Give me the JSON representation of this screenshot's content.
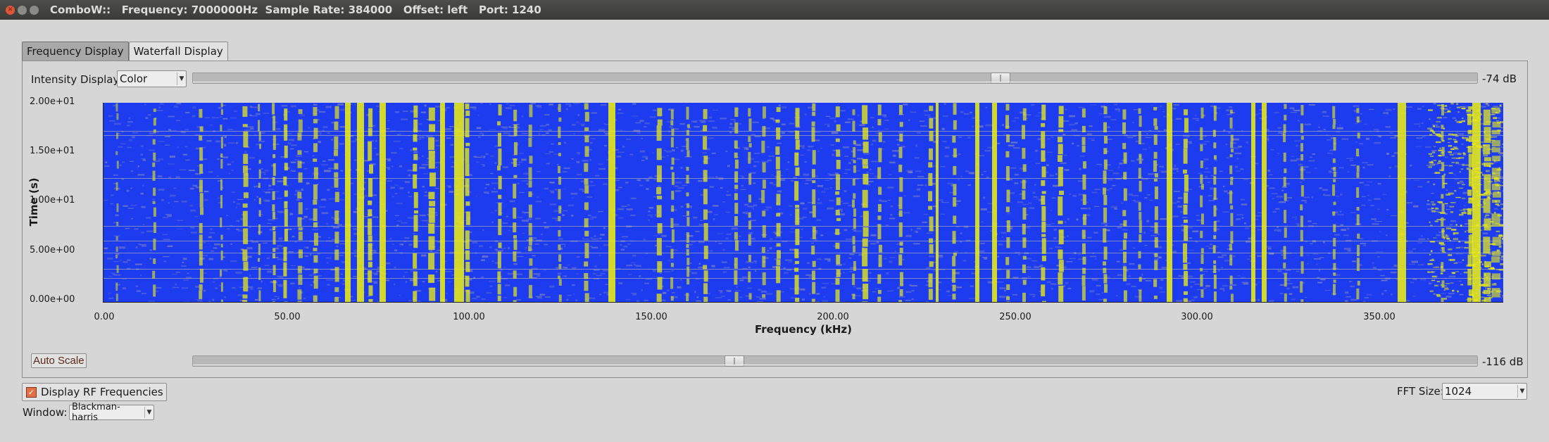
{
  "window": {
    "title": "ComboW::   Frequency: 7000000Hz  Sample Rate: 384000   Offset: left   Port: 1240"
  },
  "tabs": [
    {
      "label": "Frequency Display",
      "active": true
    },
    {
      "label": "Waterfall Display",
      "active": false
    }
  ],
  "intensity": {
    "label": "Intensity Display:",
    "selected": "Color",
    "max_db_label": "-74 dB",
    "max_slider_fraction": 0.63,
    "min_db_label": "-116 dB",
    "min_slider_fraction": 0.42
  },
  "waterfall": {
    "ylabel": "Time (s)",
    "xlabel": "Frequency (kHz)",
    "yticks": [
      "2.00e+01",
      "1.50e+01",
      "1.00e+01",
      "5.00e+00",
      "0.00e+00"
    ],
    "xticks": [
      "0.00",
      "50.00",
      "100.00",
      "150.00",
      "200.00",
      "250.00",
      "300.00",
      "350.00"
    ],
    "x_range_khz": [
      0,
      384
    ],
    "y_range_s": [
      0,
      20
    ],
    "colors": {
      "background": "#1d3cf0",
      "signal": "#f2f20a"
    }
  },
  "buttons": {
    "auto_scale": "Auto Scale"
  },
  "options": {
    "display_rf_label": "Display RF Frequencies",
    "display_rf_checked": true,
    "window_label": "Window:",
    "window_selected": "Blackman-harris",
    "fft_label": "FFT Size:",
    "fft_selected": "1024"
  },
  "icons": {
    "close": "close-icon",
    "minimize": "minimize-icon",
    "maximize": "maximize-icon",
    "dropdown": "chevron-down-icon",
    "check": "checkmark-icon"
  }
}
